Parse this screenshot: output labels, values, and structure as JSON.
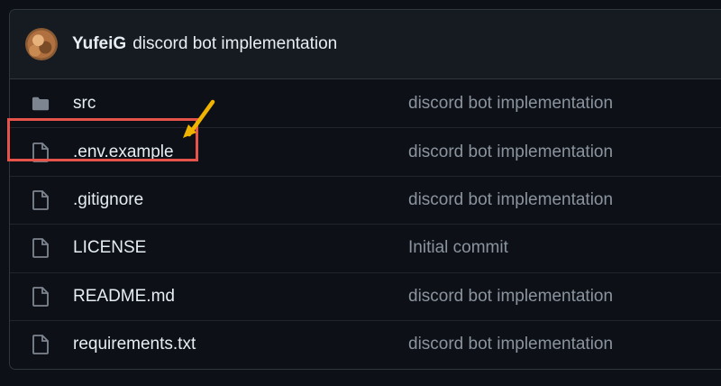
{
  "commit": {
    "author": "YufeiG",
    "message": "discord bot implementation"
  },
  "files": [
    {
      "name": "src",
      "type": "folder",
      "commit": "discord bot implementation"
    },
    {
      "name": ".env.example",
      "type": "file",
      "commit": "discord bot implementation"
    },
    {
      "name": ".gitignore",
      "type": "file",
      "commit": "discord bot implementation"
    },
    {
      "name": "LICENSE",
      "type": "file",
      "commit": "Initial commit"
    },
    {
      "name": "README.md",
      "type": "file",
      "commit": "discord bot implementation"
    },
    {
      "name": "requirements.txt",
      "type": "file",
      "commit": "discord bot implementation"
    }
  ],
  "colors": {
    "background": "#0d1117",
    "header": "#161b22",
    "border": "#30363d",
    "text": "#e6edf3",
    "muted": "#8b949e",
    "highlight": "#e5534b",
    "arrow": "#f0b400"
  },
  "icons": {
    "folder": "folder-icon",
    "file": "file-icon",
    "annotation": "arrow-icon"
  }
}
